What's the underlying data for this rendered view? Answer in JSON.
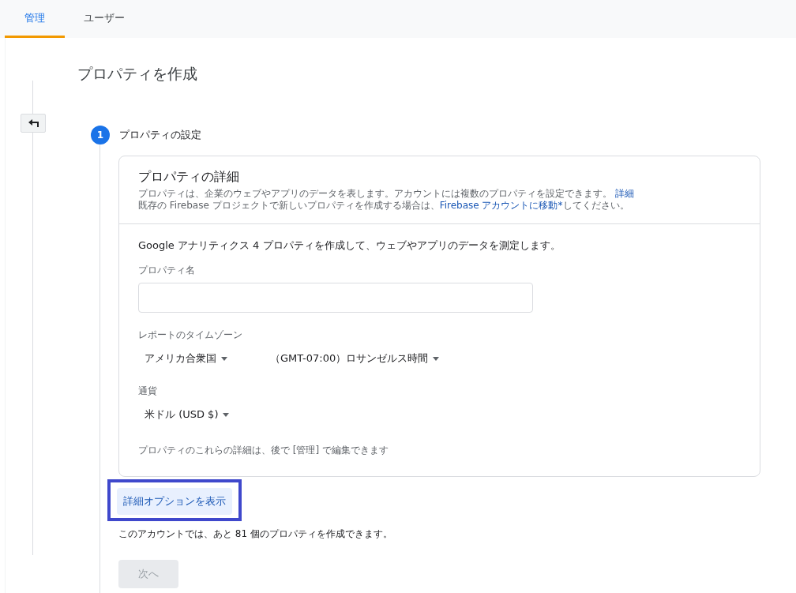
{
  "tabs": [
    {
      "label": "管理",
      "selected": true
    },
    {
      "label": "ユーザー",
      "selected": false
    }
  ],
  "page_title": "プロパティを作成",
  "step": {
    "number": "1",
    "label": "プロパティの設定",
    "active": true
  },
  "card": {
    "title": "プロパティの詳細",
    "description": [
      {
        "kind": "text",
        "text": "プロパティは、企業のウェブやアプリのデータを表します。アカウントには複数のプロパティを設定できます。 "
      },
      {
        "kind": "link",
        "text": "詳細"
      }
    ],
    "firebase_note": [
      {
        "kind": "text",
        "text": "既存の Firebase プロジェクトで新しいプロパティを作成する場合は、"
      },
      {
        "kind": "link",
        "text": "Firebase アカウントに移動*"
      },
      {
        "kind": "text",
        "text": "してください。"
      }
    ],
    "intro": "Google アナリティクス 4 プロパティを作成して、ウェブやアプリのデータを測定します。",
    "property_name": {
      "label": "プロパティ名"
    },
    "timezone": {
      "label": "レポートのタイムゾーン",
      "country": "アメリカ合衆国",
      "zone": "（GMT-07:00）ロサンゼルス時間"
    },
    "currency": {
      "label": "通貨",
      "value": "米ドル (USD $)"
    },
    "footnote": "プロパティのこれらの詳細は、後で [管理] で編集できます"
  },
  "advanced_button": {
    "label": "詳細オプションを表示",
    "highlighted": true
  },
  "remaining_note": "このアカウントでは、あと 81 個のプロパティを作成できます。",
  "next_button": {
    "label": "次へ",
    "disabled": true
  }
}
